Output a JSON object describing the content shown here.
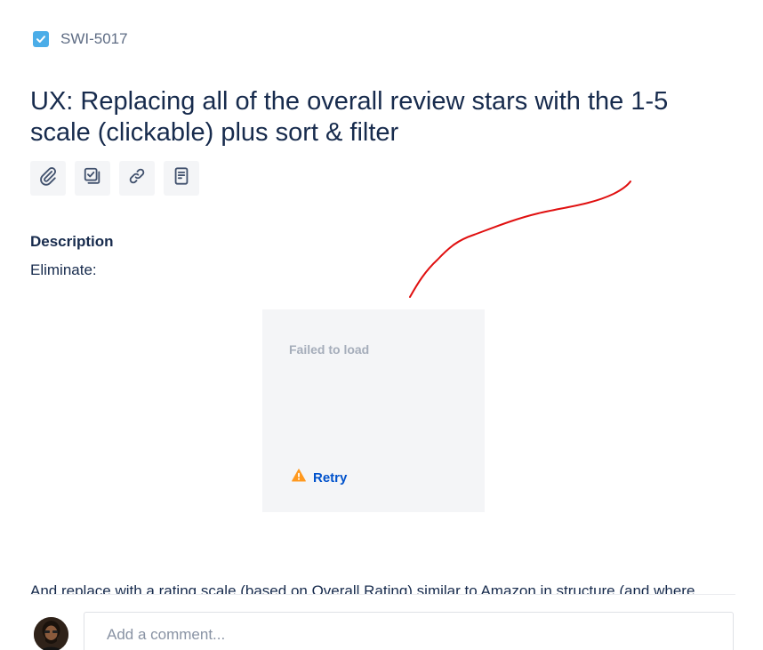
{
  "issue": {
    "key": "SWI-5017",
    "type_icon": "checkbox-icon",
    "title": "UX: Replacing all of the overall review stars with the 1-5 scale (clickable) plus sort & filter"
  },
  "toolbar": {
    "items": [
      {
        "icon": "attachment-icon"
      },
      {
        "icon": "child-issue-icon"
      },
      {
        "icon": "link-icon"
      },
      {
        "icon": "page-icon"
      }
    ]
  },
  "description": {
    "heading": "Description",
    "text": "Eliminate:",
    "media": {
      "error_text": "Failed to load",
      "retry_label": "Retry",
      "warning_icon": "warning-icon"
    },
    "continued_text": "And replace with a rating scale (based on Overall Rating) similar to Amazon in structure (and where"
  },
  "comment": {
    "placeholder": "Add a comment..."
  },
  "colors": {
    "accent": "#0052cc",
    "issue_type": "#4bade8",
    "warning": "#ff991f",
    "annotation": "#e01010"
  }
}
